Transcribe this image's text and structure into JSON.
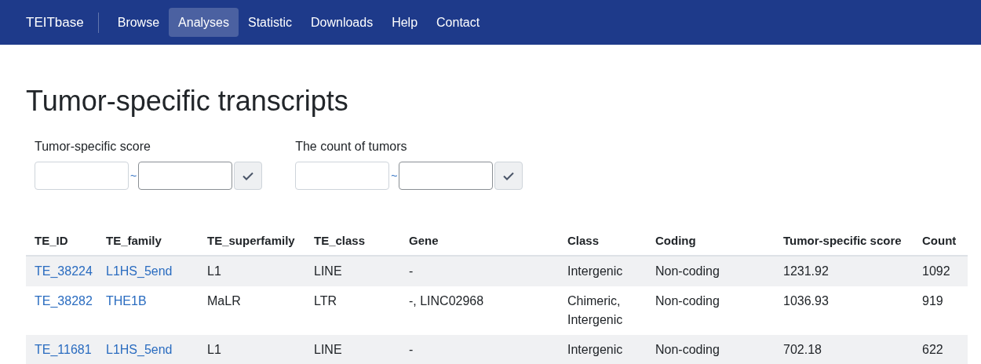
{
  "navbar": {
    "brand": "TEITbase",
    "links": [
      {
        "label": "Browse",
        "selected": false
      },
      {
        "label": "Analyses",
        "selected": true
      },
      {
        "label": "Statistic",
        "selected": false
      },
      {
        "label": "Downloads",
        "selected": false
      },
      {
        "label": "Help",
        "selected": false
      },
      {
        "label": "Contact",
        "selected": false
      }
    ]
  },
  "page_title": "Tumor-specific transcripts",
  "filters": [
    {
      "label": "Tumor-specific score",
      "separator": "~"
    },
    {
      "label": "The count of tumors",
      "separator": "~"
    }
  ],
  "table": {
    "columns": [
      {
        "label": "TE_ID",
        "kind": "link"
      },
      {
        "label": "TE_family",
        "kind": "link"
      },
      {
        "label": "TE_superfamily",
        "kind": "text"
      },
      {
        "label": "TE_class",
        "kind": "text"
      },
      {
        "label": "Gene",
        "kind": "text"
      },
      {
        "label": "Class",
        "kind": "text"
      },
      {
        "label": "Coding",
        "kind": "text"
      },
      {
        "label": "Tumor-specific score",
        "kind": "text"
      },
      {
        "label": "Count",
        "kind": "text"
      }
    ],
    "rows": [
      [
        "TE_38224",
        "L1HS_5end",
        "L1",
        "LINE",
        "-",
        "Intergenic",
        "Non-coding",
        "1231.92",
        "1092"
      ],
      [
        "TE_38282",
        "THE1B",
        "MaLR",
        "LTR",
        "-, LINC02968",
        "Chimeric, Intergenic",
        "Non-coding",
        "1036.93",
        "919"
      ],
      [
        "TE_11681",
        "L1HS_5end",
        "L1",
        "LINE",
        "-",
        "Intergenic",
        "Non-coding",
        "702.18",
        "622"
      ]
    ]
  }
}
